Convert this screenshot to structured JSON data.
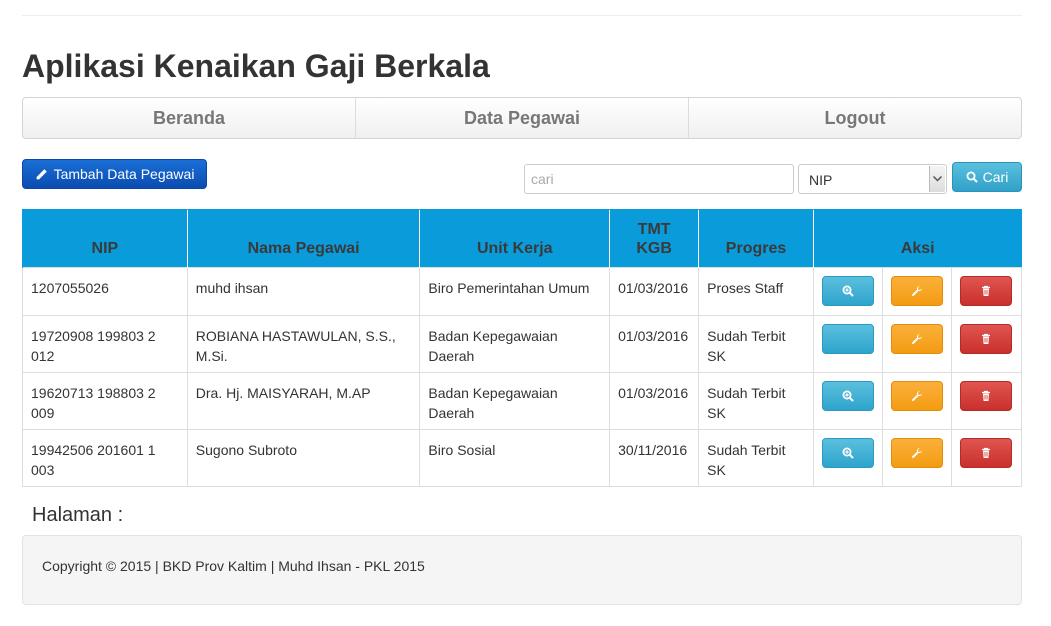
{
  "app": {
    "title": "Aplikasi Kenaikan Gaji Berkala"
  },
  "nav": {
    "items": [
      {
        "label": "Beranda"
      },
      {
        "label": "Data Pegawai"
      },
      {
        "label": "Logout"
      }
    ]
  },
  "toolbar": {
    "add_label": "Tambah Data Pegawai",
    "add_icon": "pencil-icon",
    "search_placeholder": "cari",
    "search_value": "",
    "filter_selected": "NIP",
    "search_button_label": "Cari",
    "search_icon": "search-icon"
  },
  "table": {
    "columns": {
      "nip": "NIP",
      "nama": "Nama Pegawai",
      "unit": "Unit Kerja",
      "tmt_line1": "TMT",
      "tmt_line2": "KGB",
      "progres": "Progres",
      "aksi": "Aksi"
    },
    "rows": [
      {
        "nip": "1207055026",
        "nama": "muhd ihsan",
        "unit": "Biro Pemerintahan Umum",
        "tmt": "01/03/2016",
        "progres": "Proses Staff",
        "view_icon": true
      },
      {
        "nip": "19720908 199803 2 012",
        "nama": "ROBIANA HASTAWULAN, S.S., M.Si.",
        "unit": "Badan Kepegawaian Daerah",
        "tmt": "01/03/2016",
        "progres": "Sudah Terbit SK",
        "view_icon": false
      },
      {
        "nip": "19620713 198803 2 009",
        "nama": "Dra. Hj. MAISYARAH, M.AP",
        "unit": "Badan Kepegawaian Daerah",
        "tmt": "01/03/2016",
        "progres": "Sudah Terbit SK",
        "view_icon": true
      },
      {
        "nip": "19942506 201601 1 003",
        "nama": "Sugono Subroto",
        "unit": "Biro Sosial",
        "tmt": "30/11/2016",
        "progres": "Sudah Terbit SK",
        "view_icon": true
      }
    ],
    "action_icons": {
      "view": "zoom-in-icon",
      "edit": "wrench-icon",
      "delete": "trash-icon"
    }
  },
  "pagination": {
    "label": "Halaman :"
  },
  "footer": {
    "text": "Copyright © 2015 | BKD Prov Kaltim | Muhd Ihsan - PKL 2015"
  },
  "colors": {
    "header_bg": "#0a9bdb",
    "primary": "#0b4cb0",
    "info": "#5bc0de",
    "warning": "#f39c12",
    "danger": "#c9302c"
  }
}
